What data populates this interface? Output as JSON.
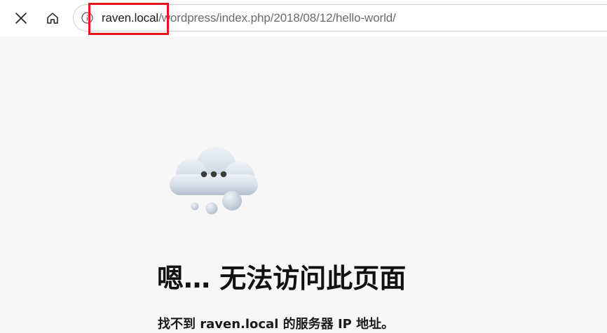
{
  "toolbar": {
    "close_icon": "close-icon",
    "home_icon": "home-icon"
  },
  "address_bar": {
    "info_icon": "info-icon",
    "host": "raven.local",
    "path": "/wordpress/index.php/2018/08/12/hello-world/",
    "highlight_color": "#e4141b"
  },
  "error_page": {
    "illustration": "cloud-with-dots-illustration",
    "title": "嗯… 无法访问此页面",
    "detail": "找不到 raven.local 的服务器 IP 地址。"
  }
}
